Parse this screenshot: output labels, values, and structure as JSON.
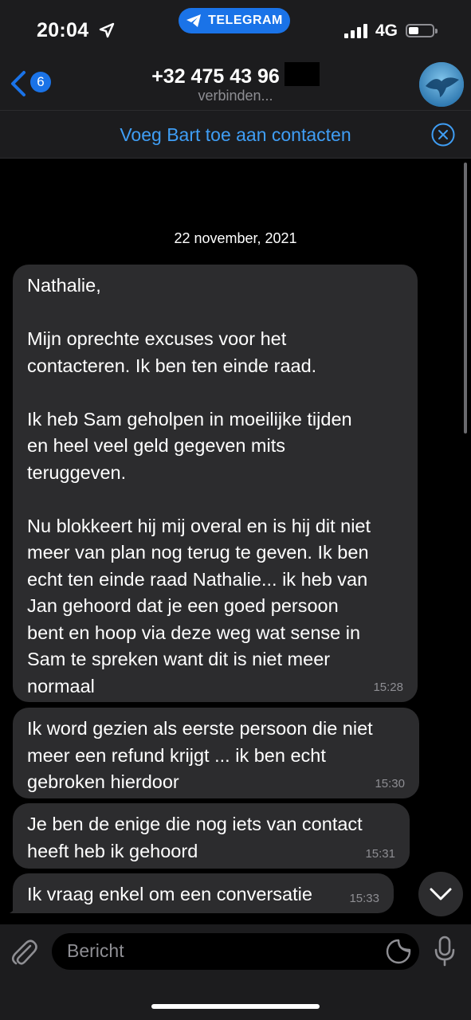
{
  "status_bar": {
    "time": "20:04",
    "app_pill": "TELEGRAM",
    "network": "4G"
  },
  "header": {
    "back_badge": "6",
    "title": "+32 475 43 96",
    "subtitle": "verbinden..."
  },
  "banner": {
    "text": "Voeg Bart toe aan contacten"
  },
  "chat": {
    "date": "22 november, 2021",
    "messages": [
      {
        "text": "Nathalie,\n\nMijn oprechte excuses voor het\ncontacteren. Ik ben ten einde raad.\n\nIk heb Sam geholpen in moeilijke tijden\nen heel veel geld gegeven mits\nteruggeven.\n\nNu blokkeert hij mij overal en is hij dit niet\nmeer van plan nog terug te geven. Ik ben\necht ten einde raad Nathalie... ik heb van\nJan gehoord dat je een goed persoon\nbent en hoop via deze weg wat sense in\nSam te spreken want dit is niet meer\nnormaal",
        "time": "15:28"
      },
      {
        "text": "Ik word gezien als eerste persoon die niet\nmeer een refund krijgt ... ik ben echt\ngebroken hierdoor",
        "time": "15:30"
      },
      {
        "text": "Je ben de enige die nog iets van contact\nheeft heb ik gehoord",
        "time": "15:31"
      },
      {
        "text": "Ik vraag enkel om een conversatie",
        "time": "15:33"
      }
    ]
  },
  "input": {
    "placeholder": "Bericht"
  },
  "colors": {
    "accent": "#1a73e8",
    "link": "#3f9ef5",
    "bubble": "#2c2c2e",
    "bar": "#1c1c1e"
  },
  "icons": [
    "location-arrow-icon",
    "telegram-plane-icon",
    "signal-icon",
    "battery-icon",
    "back-chevron-icon",
    "close-circle-icon",
    "chevron-down-icon",
    "paperclip-icon",
    "sticker-icon",
    "microphone-icon"
  ]
}
